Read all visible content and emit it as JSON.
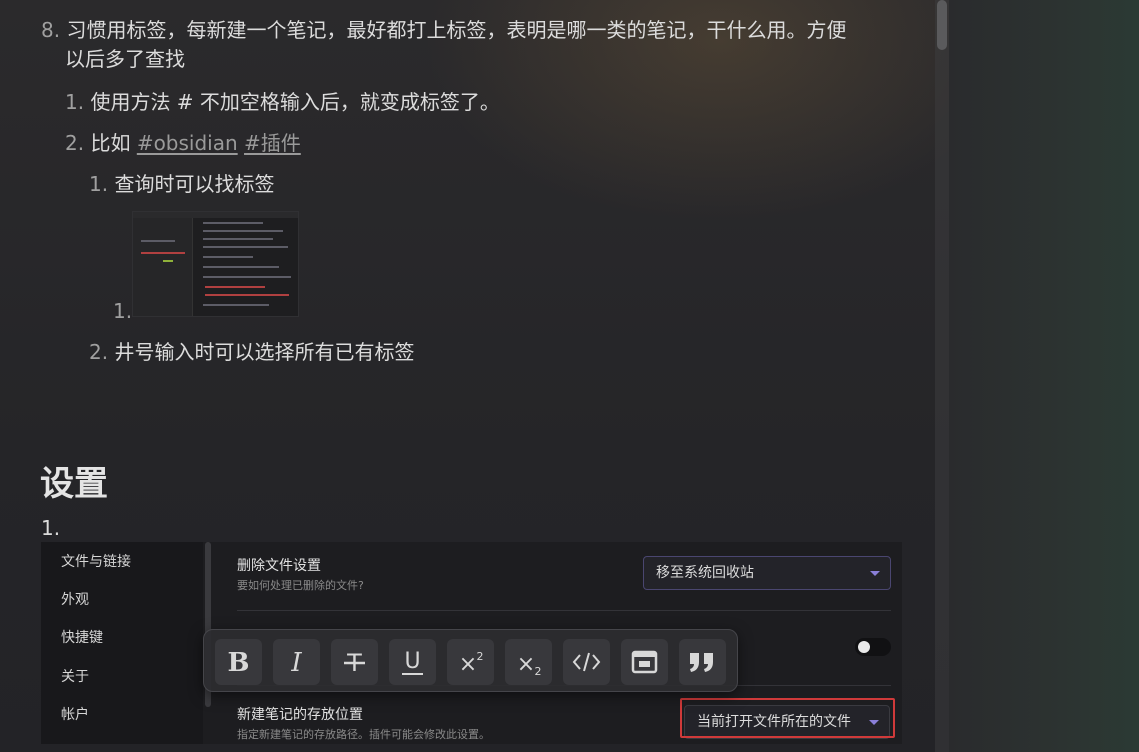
{
  "editor": {
    "item8": {
      "number": "8.",
      "line1": "习惯用标签，每新建一个笔记，最好都打上标签，表明是哪一类的笔记，干什么用。方便",
      "line2": "以后多了查找"
    },
    "sub1": {
      "number": "1.",
      "text": "使用方法 # 不加空格输入后，就变成标签了。"
    },
    "sub2": {
      "number": "2.",
      "text": "比如 ",
      "tags": [
        "#obsidian",
        "#插件"
      ]
    },
    "subsub1": {
      "number": "1.",
      "text": "查询时可以找标签"
    },
    "image_item_number": "1.",
    "subsub2": {
      "number": "2.",
      "text": "井号输入时可以选择所有已有标签"
    },
    "heading": "设置",
    "settings_item_number": "1."
  },
  "settings": {
    "nav": [
      "文件与链接",
      "外观",
      "快捷键",
      "关于",
      "帐户"
    ],
    "rows": [
      {
        "title": "删除文件设置",
        "desc": "要如何处理已删除的文件?",
        "value": "移至系统回收站"
      },
      {
        "title": "新建笔记的存放位置",
        "desc": "指定新建笔记的存放路径。插件可能会修改此设置。",
        "value": "当前打开文件所在的文件夹"
      }
    ]
  },
  "toolbar": {
    "buttons": [
      {
        "name": "bold",
        "glyph": "B"
      },
      {
        "name": "italic",
        "glyph": "I"
      },
      {
        "name": "strikethrough",
        "glyph": "T"
      },
      {
        "name": "underline",
        "glyph": "U"
      },
      {
        "name": "superscript",
        "glyph": "X²"
      },
      {
        "name": "subscript",
        "glyph": "X₂"
      },
      {
        "name": "code",
        "glyph": "</>"
      },
      {
        "name": "embed",
        "glyph": "▣"
      },
      {
        "name": "quote",
        "glyph": "❞"
      }
    ]
  },
  "colors": {
    "accent": "#8a7fd8",
    "highlight_box": "#d03a3a",
    "tag_text": "#9a9a9a"
  }
}
